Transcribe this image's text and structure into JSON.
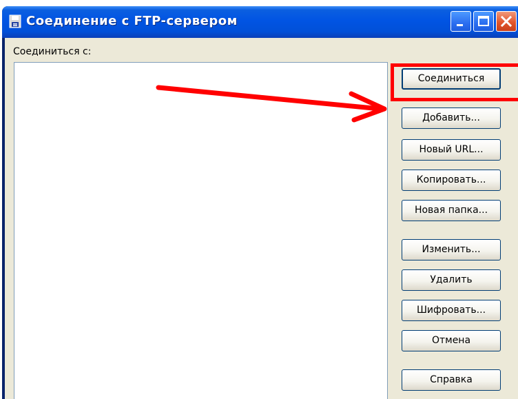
{
  "window": {
    "title": "Соединение с FTP-сервером"
  },
  "dialog": {
    "connect_to_label": "Соединиться с:",
    "buttons": [
      "Соединиться",
      "Добавить...",
      "Новый URL...",
      "Копировать...",
      "Новая папка...",
      "Изменить...",
      "Удалить",
      "Шифровать...",
      "Отмена",
      "Справка"
    ]
  },
  "annotation": {
    "color": "#ff0000",
    "target": "Добавить..."
  }
}
